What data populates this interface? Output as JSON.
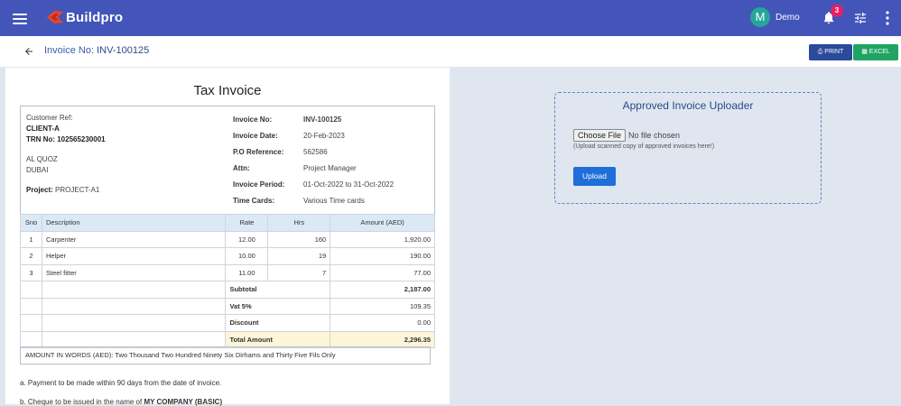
{
  "header": {
    "app_name": "Buildpro",
    "user_initial": "M",
    "user_name": "Demo",
    "notification_count": "3",
    "brand_color": "#4355b9",
    "icons": [
      "menu-icon",
      "buildpro-logo",
      "bell-icon",
      "tune-icon",
      "more-vert-icon"
    ]
  },
  "subheader": {
    "title_label": "Invoice No:",
    "title_value": "INV-100125",
    "print_label": "PRINT",
    "excel_label": "EXCEL"
  },
  "invoice": {
    "title": "Tax Invoice",
    "customer": {
      "ref_label": "Customer Ref:",
      "name": "CLIENT-A",
      "trn": "TRN No: 102565230001",
      "address1": "AL QUOZ",
      "address2": "DUBAI",
      "project_label": "Project:",
      "project_value": "PROJECT-A1"
    },
    "meta": [
      {
        "label": "Invoice No:",
        "value": "INV-100125"
      },
      {
        "label": "Invoice Date:",
        "value": "20-Feb-2023"
      },
      {
        "label": "P.O Reference:",
        "value": "562586"
      },
      {
        "label": "Attn:",
        "value": "Project Manager"
      },
      {
        "label": "Invoice Period:",
        "value": "01-Oct-2022 to 31-Oct-2022"
      },
      {
        "label": "Time Cards:",
        "value": "Various Time cards"
      }
    ],
    "columns": [
      "Sno",
      "Description",
      "Rate",
      "Hrs",
      "Amount (AED)"
    ],
    "rows": [
      {
        "sno": "1",
        "desc": "Carpenter",
        "rate": "12.00",
        "hrs": "160",
        "amount": "1,920.00"
      },
      {
        "sno": "2",
        "desc": "Helper",
        "rate": "10.00",
        "hrs": "19",
        "amount": "190.00"
      },
      {
        "sno": "3",
        "desc": "Steel fitter",
        "rate": "11.00",
        "hrs": "7",
        "amount": "77.00"
      }
    ],
    "totals": [
      {
        "label": "Subtotal",
        "value": "2,187.00"
      },
      {
        "label": "Vat 5%",
        "value": "109.35"
      },
      {
        "label": "Discount",
        "value": "0.00"
      },
      {
        "label": "Total Amount",
        "value": "2,296.35"
      }
    ],
    "amount_in_words": "AMOUNT IN WORDS (AED): Two Thousand Two Hundred Ninety Six Dirhams and Thirty Five Fils Only",
    "note1": "a. Payment to be made within 90 days from the date of invoice.",
    "note2_prefix": "b. Cheque to be issued in the name of",
    "note2_company": "MY COMPANY (BASIC)"
  },
  "uploader": {
    "title": "Approved Invoice Uploader",
    "choose_label": "Choose File",
    "file_status": "No file chosen",
    "hint": "(Upload scanned copy of approved invoices here!)",
    "upload_label": "Upload"
  }
}
